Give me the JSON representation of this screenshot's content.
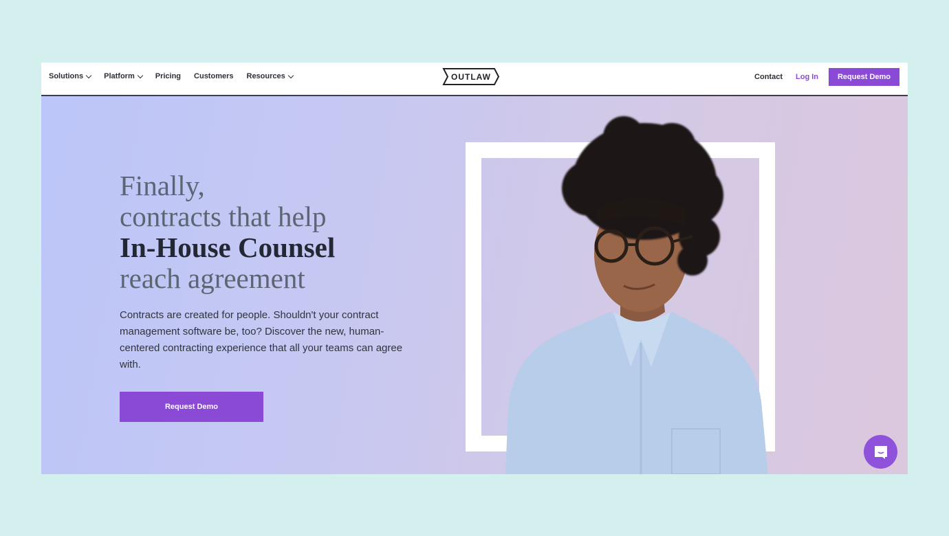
{
  "nav": {
    "items": [
      {
        "label": "Solutions",
        "dropdown": true
      },
      {
        "label": "Platform",
        "dropdown": true
      },
      {
        "label": "Pricing",
        "dropdown": false
      },
      {
        "label": "Customers",
        "dropdown": false
      },
      {
        "label": "Resources",
        "dropdown": true
      }
    ],
    "logo_text": "OUTLAW",
    "contact_label": "Contact",
    "login_label": "Log In",
    "cta_label": "Request Demo"
  },
  "hero": {
    "headline_line1": "Finally,",
    "headline_line2": "contracts that help",
    "headline_line3": "In-House Counsel",
    "headline_line4": "reach agreement",
    "body": "Contracts are created for people. Shouldn't your contract management software be, too? Discover the new, human-centered contracting experience that all your teams can agree with.",
    "cta_label": "Request Demo",
    "image_alt": "Smiling woman with curly hair and glasses wearing a light blue shirt"
  },
  "chat_widget": {
    "icon": "chat-bubble-icon"
  },
  "colors": {
    "accent": "#8a4ad6",
    "page_background": "#d3f0ef",
    "heading_dark": "#232833",
    "heading_light": "#5d6573"
  }
}
